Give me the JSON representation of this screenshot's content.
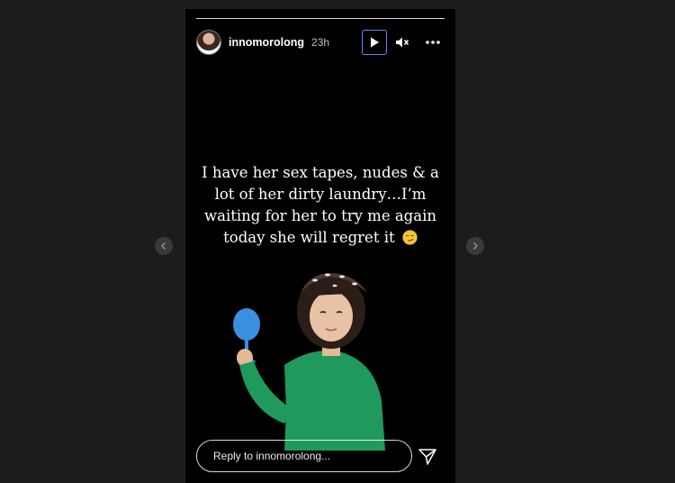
{
  "story": {
    "username": "innomorolong",
    "time": "23h",
    "caption": "I have her sex tapes, nudes & a lot of her dirty laundry…I’m waiting for her to try me again today she will regret it",
    "caption_emoji": "smirking-face-emoji",
    "progress_segments": 1
  },
  "reply": {
    "placeholder": "Reply to innomorolong..."
  },
  "icons": {
    "play": "play-icon",
    "mute": "speaker-muted-icon",
    "more": "more-options-icon",
    "send": "send-icon",
    "prev": "chevron-left-icon",
    "next": "chevron-right-icon"
  },
  "colors": {
    "page_background": "#1c1c1c",
    "story_background": "#000000",
    "focus_ring": "#5b8def",
    "sweater": "#1f9a5c",
    "glass": "#3b8fe0"
  }
}
